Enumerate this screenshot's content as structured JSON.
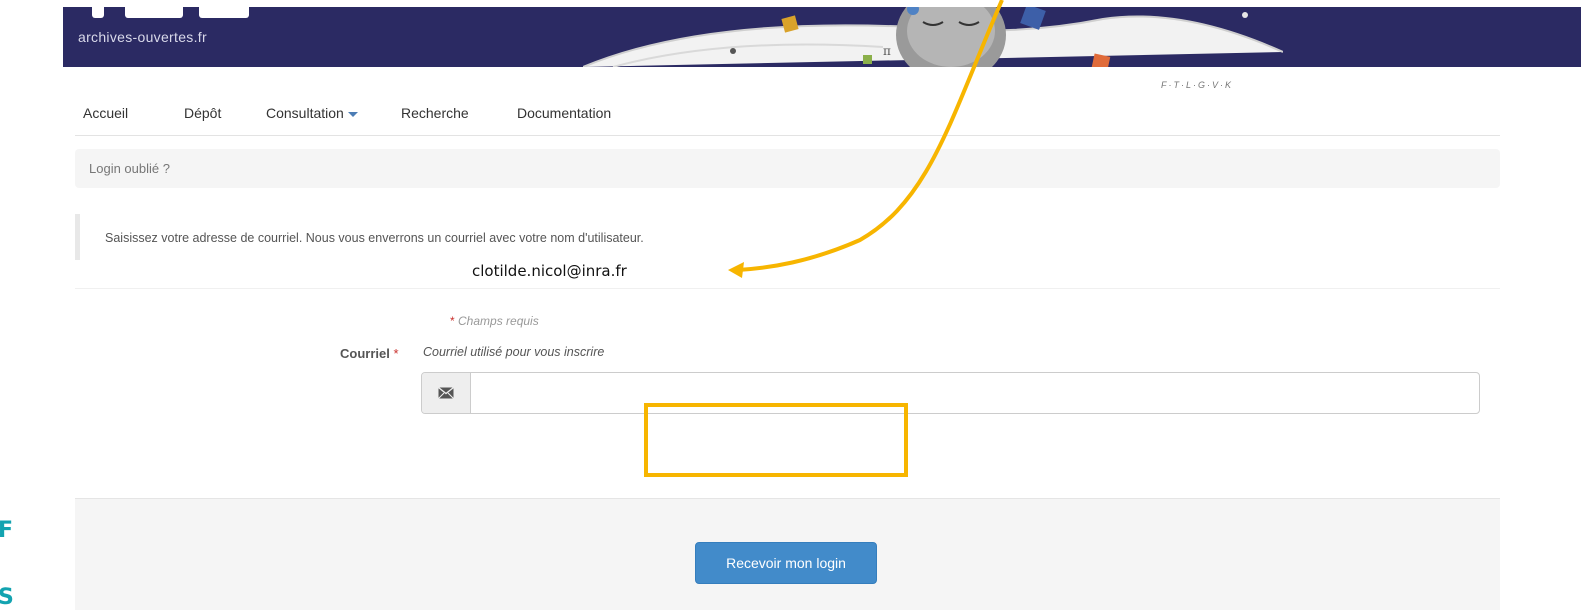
{
  "header": {
    "logo_text": "archives-ouvertes.fr",
    "signature": "F·T·L·G·V·K"
  },
  "nav": {
    "items": [
      {
        "label": "Accueil"
      },
      {
        "label": "Dépôt"
      },
      {
        "label": "Consultation",
        "has_dropdown": true
      },
      {
        "label": "Recherche"
      },
      {
        "label": "Documentation"
      }
    ]
  },
  "breadcrumb": {
    "label": "Login oublié ?"
  },
  "note": {
    "text": "Saisissez votre adresse de courriel. Nous vous enverrons un courriel avec votre nom d'utilisateur."
  },
  "annotation": {
    "email": "clotilde.nicol@inra.fr",
    "color": "#f7b500"
  },
  "form": {
    "required_marker": "*",
    "required_hint": "Champs requis",
    "email_label": "Courriel",
    "email_help": "Courriel utilisé pour vous inscrire",
    "email_value": "",
    "email_icon": "envelope-icon",
    "submit_label": "Recevoir mon login",
    "accent_color": "#428bca"
  },
  "edge_fragments": [
    "F",
    "S"
  ]
}
